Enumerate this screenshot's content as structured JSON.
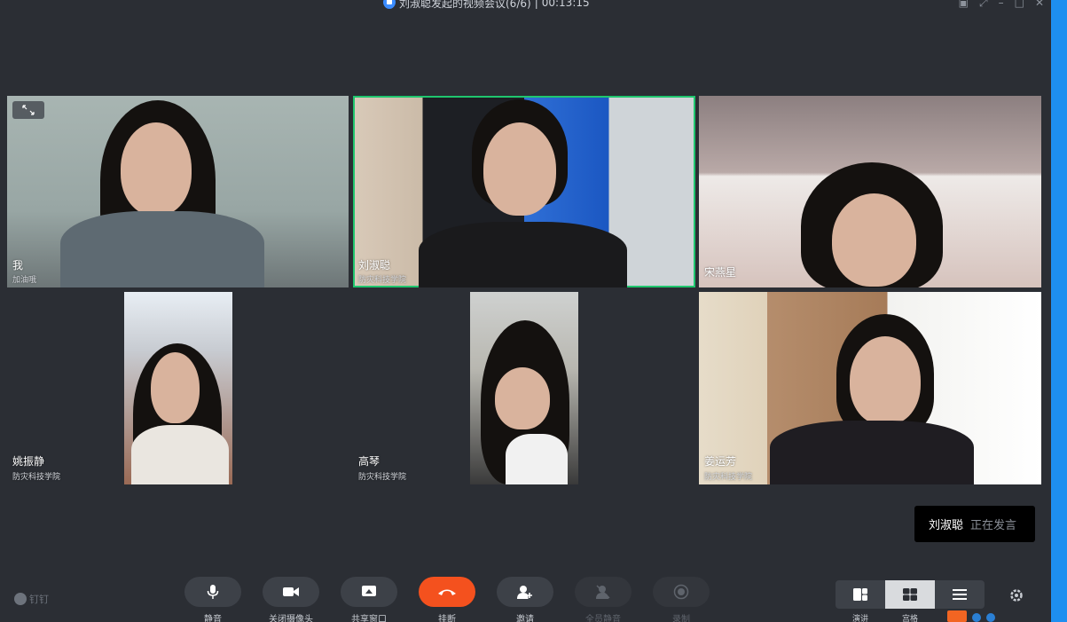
{
  "window": {
    "title": "刘淑聪发起的视频会议(6/6)",
    "separator": "|",
    "timer": "00:13:15"
  },
  "participants": [
    {
      "name": "我",
      "org": "加油哦"
    },
    {
      "name": "刘淑聪",
      "org": "防灾科技学院"
    },
    {
      "name": "宋燕星",
      "org": ""
    },
    {
      "name": "姚振静",
      "org": "防灾科技学院"
    },
    {
      "name": "高琴",
      "org": "防灾科技学院"
    },
    {
      "name": "姜运芳",
      "org": "防灾科技学院"
    }
  ],
  "speaking": {
    "who": "刘淑聪",
    "state": "正在发言"
  },
  "brand": "钉钉",
  "toolbar": {
    "mute": "静音",
    "camera": "关闭摄像头",
    "share": "共享窗口",
    "hangup": "挂断",
    "invite": "邀请",
    "mute_all": "全员静音",
    "record": "录制"
  },
  "layouts": {
    "speaker": "演讲",
    "grid": "宫格",
    "list": ""
  },
  "colors": {
    "background": "#2b2e34",
    "active_border": "#1fc66e",
    "hangup": "#f4511e",
    "accent": "#1e8ff0"
  },
  "icons": [
    "shield-icon",
    "expand-icon",
    "microphone-icon",
    "camera-icon",
    "share-screen-icon",
    "phone-hangup-icon",
    "invite-user-icon",
    "mute-all-icon",
    "record-icon",
    "speaker-layout-icon",
    "grid-layout-icon",
    "list-layout-icon",
    "gear-icon"
  ]
}
